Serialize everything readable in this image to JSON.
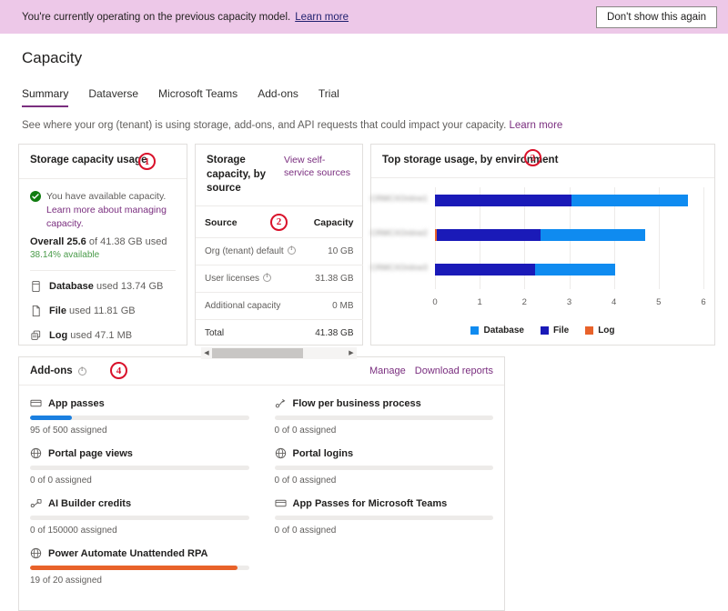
{
  "banner": {
    "text": "You're currently operating on the previous capacity model.",
    "link_label": "Learn more",
    "dismiss_label": "Don't show this again",
    "bg_color": "#edc8e8"
  },
  "header": {
    "title": "Capacity",
    "tabs": [
      {
        "label": "Summary",
        "active": true
      },
      {
        "label": "Dataverse",
        "active": false
      },
      {
        "label": "Microsoft Teams",
        "active": false
      },
      {
        "label": "Add-ons",
        "active": false
      },
      {
        "label": "Trial",
        "active": false
      }
    ],
    "subtext": "See where your org (tenant) is using storage, add-ons, and API requests that could impact your capacity.",
    "subtext_link": "Learn more",
    "accent_color": "#7a2e7f"
  },
  "callouts": [
    {
      "number": "1"
    },
    {
      "number": "2"
    },
    {
      "number": "3"
    },
    {
      "number": "4"
    }
  ],
  "storage_usage_card": {
    "title": "Storage capacity usage",
    "badge": "1",
    "status_message": "You have available capacity.",
    "status_link": "Learn more about managing capacity.",
    "status_icon": "check-circle-icon",
    "status_color": "#107c10",
    "overall_prefix": "Overall",
    "overall_value": "25.6",
    "overall_suffix": "of 41.38 GB used",
    "available_text": "38.14% available",
    "available_color": "#4a9b4a",
    "breakdown": [
      {
        "icon": "database-icon",
        "label": "Database",
        "value": "used 13.74 GB"
      },
      {
        "icon": "file-icon",
        "label": "File",
        "value": "used 11.81 GB"
      },
      {
        "icon": "log-icon",
        "label": "Log",
        "value": "used 47.1 MB"
      }
    ]
  },
  "by_source_card": {
    "title": "Storage capacity, by source",
    "badge": "2",
    "self_service_link": "View self-service sources",
    "columns": [
      "Source",
      "Capacity"
    ],
    "rows": [
      {
        "source": "Org (tenant) default",
        "has_info": true,
        "capacity": "10 GB"
      },
      {
        "source": "User licenses",
        "has_info": true,
        "capacity": "31.38 GB"
      },
      {
        "source": "Additional capacity",
        "has_info": false,
        "capacity": "0 MB"
      },
      {
        "source": "Total",
        "has_info": false,
        "capacity": "41.38 GB"
      }
    ]
  },
  "top_storage_card": {
    "title": "Top storage usage, by environment",
    "badge": "3"
  },
  "chart_data": {
    "type": "bar",
    "orientation": "horizontal",
    "stacked": true,
    "title": "Top storage usage, by environment",
    "xlabel": "",
    "ylabel": "",
    "xlim": [
      0,
      6
    ],
    "xticks": [
      0,
      1,
      2,
      3,
      4,
      5,
      6
    ],
    "grid": true,
    "legend_position": "bottom",
    "categories": [
      "[redacted-env-1]",
      "[redacted-env-2]",
      "[redacted-env-3]"
    ],
    "series": [
      {
        "name": "Log",
        "color": "#e8622a",
        "values": [
          0,
          0.05,
          0
        ]
      },
      {
        "name": "File",
        "color": "#1a1ab8",
        "values": [
          3.06,
          2.3,
          2.23
        ]
      },
      {
        "name": "Database",
        "color": "#0f8bf0",
        "values": [
          2.6,
          2.35,
          1.8
        ]
      }
    ],
    "stack_order": [
      "Log",
      "File",
      "Database"
    ],
    "totals": [
      5.66,
      4.7,
      4.03
    ],
    "legend": [
      {
        "label": "Database",
        "color": "#0f8bf0"
      },
      {
        "label": "File",
        "color": "#1a1ab8"
      },
      {
        "label": "Log",
        "color": "#e8622a"
      }
    ]
  },
  "addons_card": {
    "title": "Add-ons",
    "badge": "4",
    "has_info_icon": true,
    "links": [
      "Manage",
      "Download reports"
    ],
    "items": [
      {
        "icon": "app-pass-icon",
        "name": "App passes",
        "assigned": 95,
        "total": 500,
        "caption": "95 of 500 assigned",
        "percent": 19,
        "fill_color": "#1a7fe0"
      },
      {
        "icon": "flow-icon",
        "name": "Flow per business process",
        "assigned": 0,
        "total": 0,
        "caption": "0 of 0 assigned",
        "percent": 0,
        "fill_color": "#1a7fe0"
      },
      {
        "icon": "globe-icon",
        "name": "Portal page views",
        "assigned": 0,
        "total": 0,
        "caption": "0 of 0 assigned",
        "percent": 0,
        "fill_color": "#1a7fe0"
      },
      {
        "icon": "globe-icon",
        "name": "Portal logins",
        "assigned": 0,
        "total": 0,
        "caption": "0 of 0 assigned",
        "percent": 0,
        "fill_color": "#1a7fe0"
      },
      {
        "icon": "ai-builder-icon",
        "name": "AI Builder credits",
        "assigned": 0,
        "total": 150000,
        "caption": "0 of 150000 assigned",
        "percent": 0,
        "fill_color": "#1a7fe0"
      },
      {
        "icon": "app-pass-icon",
        "name": "App Passes for Microsoft Teams",
        "assigned": 0,
        "total": 0,
        "caption": "0 of 0 assigned",
        "percent": 0,
        "fill_color": "#1a7fe0"
      },
      {
        "icon": "globe-icon",
        "name": "Power Automate Unattended RPA",
        "assigned": 19,
        "total": 20,
        "caption": "19 of 20 assigned",
        "percent": 95,
        "fill_color": "#e8622a"
      }
    ]
  }
}
